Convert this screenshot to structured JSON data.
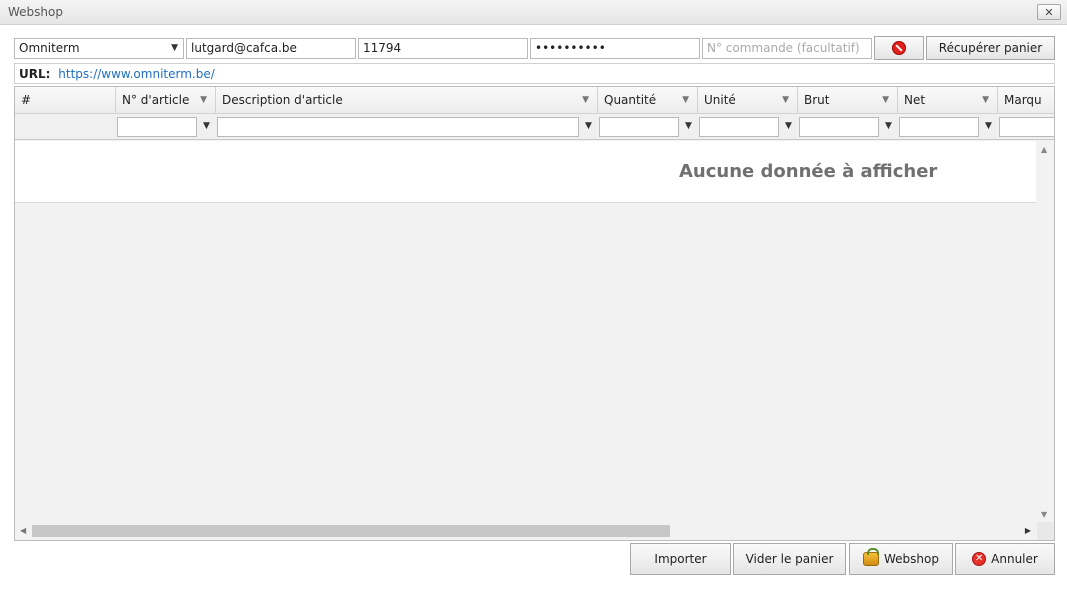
{
  "window": {
    "title": "Webshop",
    "close_glyph": "✕"
  },
  "toolbar": {
    "supplier": "Omniterm",
    "email": "lutgard@cafca.be",
    "customer_id": "11794",
    "password": "••••••••••",
    "order_placeholder": "N° commande (facultatif)",
    "fetch_label": "Récupérer panier"
  },
  "url": {
    "label": "URL:",
    "value": "https://www.omniterm.be/"
  },
  "grid": {
    "columns": [
      "#",
      "N° d'article",
      "Description d'article",
      "Quantité",
      "Unité",
      "Brut",
      "Net",
      "Marqu"
    ],
    "empty_text": "Aucune donnée à afficher"
  },
  "actions": {
    "import_label": "Importer",
    "empty_cart_label": "Vider le panier",
    "webshop_label": "Webshop",
    "cancel_label": "Annuler"
  },
  "icons": {
    "select": "chevron-down-icon",
    "funnel": "filter-funnel-icon",
    "stop": "stop-icon",
    "bag": "shopping-bag-icon",
    "cancel": "cancel-icon"
  },
  "colors": {
    "link": "#1f6fc5",
    "danger": "#e3322b",
    "empty_text": "#707070"
  }
}
